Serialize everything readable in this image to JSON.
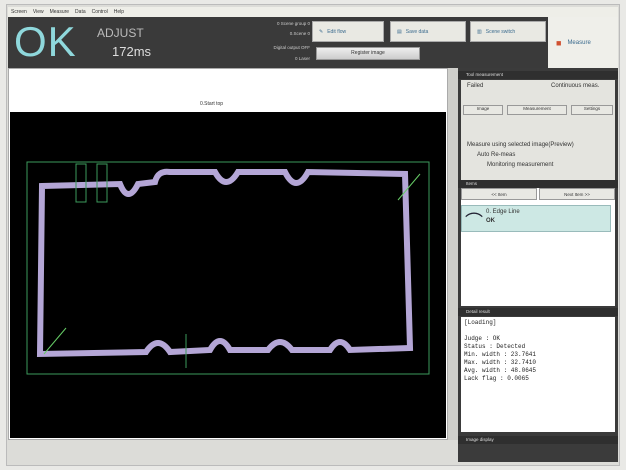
{
  "menu": [
    "Screen",
    "View",
    "Measure",
    "Data",
    "Control",
    "Help"
  ],
  "header": {
    "judge": "OK",
    "mode": "ADJUST",
    "time": "172ms",
    "info": [
      "0 Scene group 0",
      "0.Scene 0",
      "Digital output OFF",
      "0 Laser"
    ],
    "buttons": [
      "Edit flow",
      "Save data",
      "Scene switch"
    ],
    "register": "Register image",
    "measure": "Measure"
  },
  "main": {
    "title": "0.Start top"
  },
  "right": {
    "tool_header": "Tool measurement",
    "failed": "Failed",
    "cont": "Continuous meas.",
    "row_buttons": [
      "Image",
      "Measurement",
      "Settings"
    ],
    "option_main": "Measure using selected image(Preview)",
    "opt1": "Auto Re-meas",
    "opt2": "Monitoring measurement",
    "items_header": "Items",
    "prev": "<< Item",
    "next": "Next Item >>",
    "item_label": "0. Edge Line",
    "item_value": "OK",
    "detail_header": "Detail result",
    "detail": [
      "[Loading]",
      "",
      "Judge : OK",
      "Status : Detected",
      "Min. width : 23.7641",
      "Max. width : 32.7410",
      "Avg. width : 48.0645",
      "Lack flag : 0.0065"
    ],
    "image_header": "Image display"
  },
  "colors": {
    "judge": "#8fd8dc",
    "outline": "#b4a6d6",
    "region": "#3d9a5c",
    "item_bg": "#cde8e4"
  }
}
